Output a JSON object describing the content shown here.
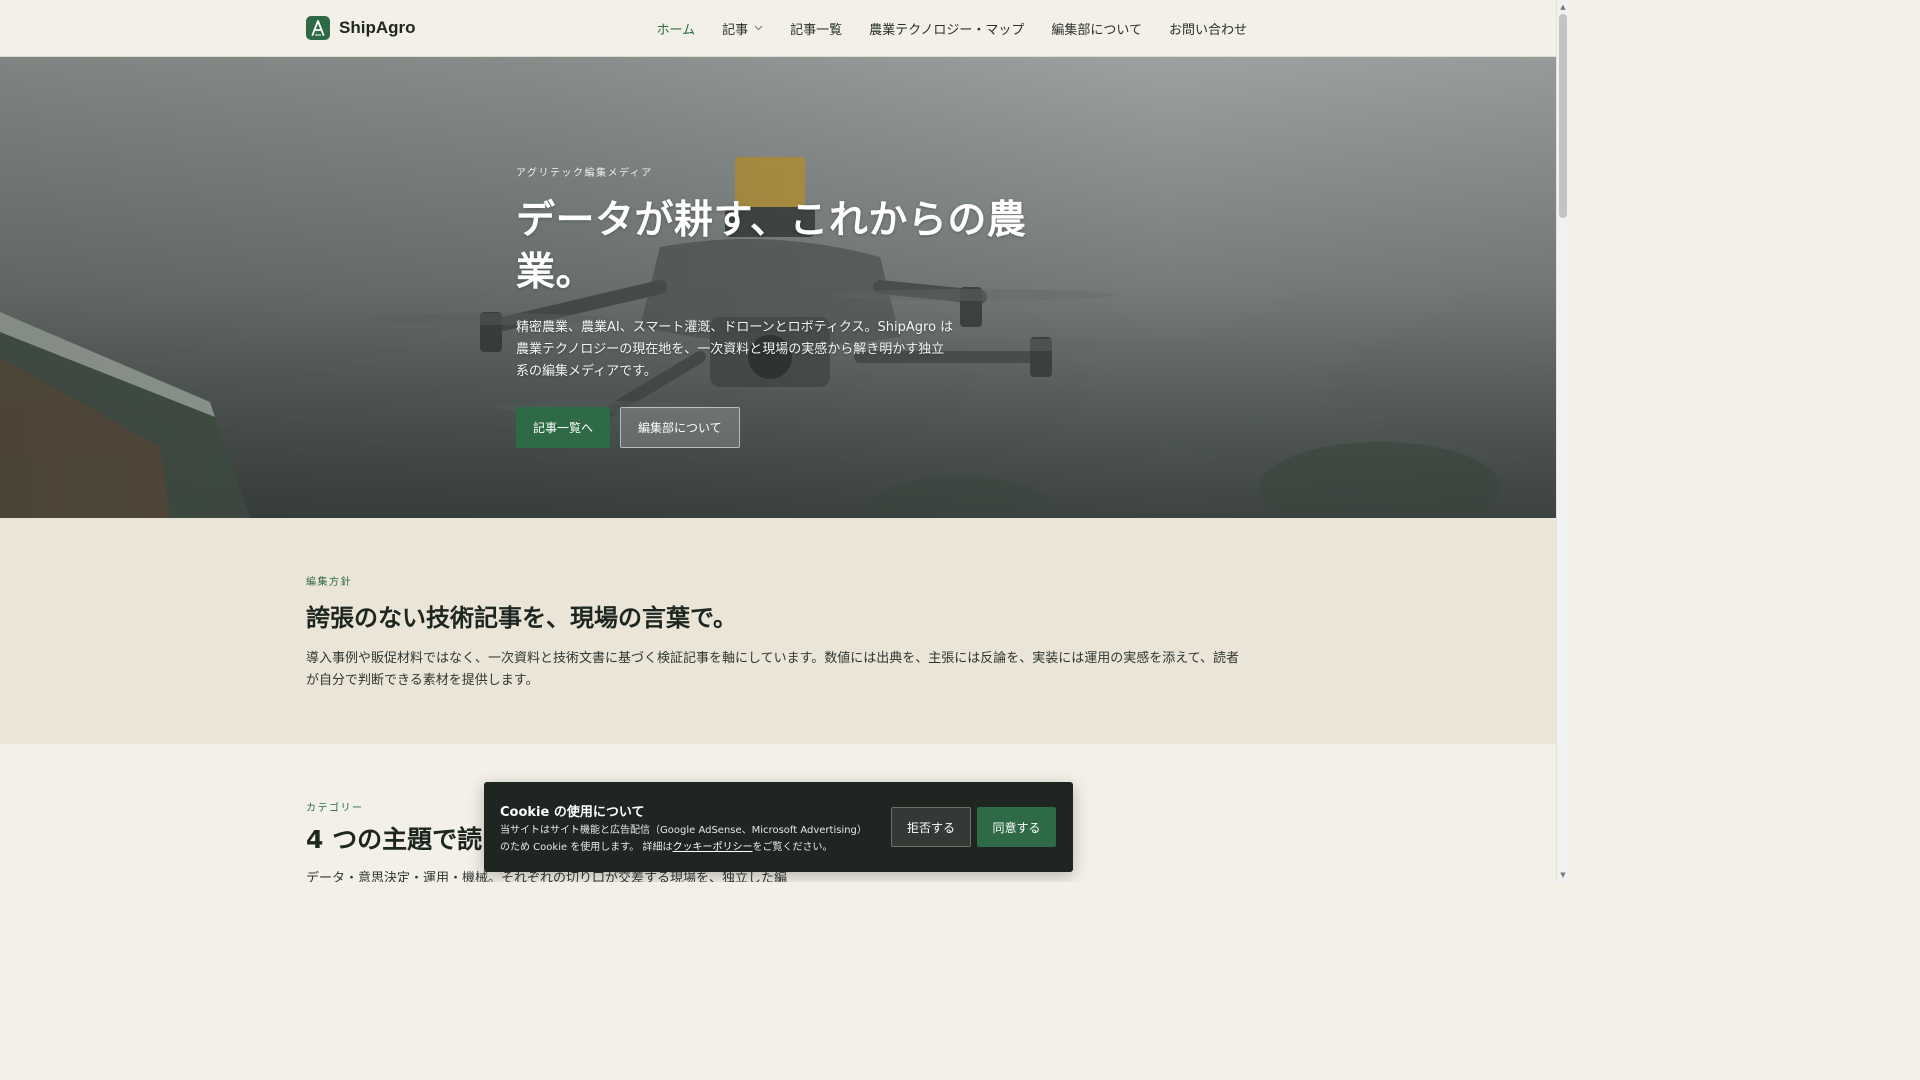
{
  "brand": {
    "name": "ShipAgro",
    "logo_icon": "leaf-a-logo-icon",
    "accent": "#2d6a45"
  },
  "nav": {
    "home": "ホーム",
    "articles": "記事",
    "article_list": "記事一覧",
    "map": "農業テクノロジー・マップ",
    "about": "編集部について",
    "contact": "お問い合わせ"
  },
  "hero": {
    "eyebrow": "アグリテック編集メディア",
    "title_line1": "データが耕す、これからの農",
    "title_line2": "業。",
    "description": "精密農業、農業AI、スマート灌漑、ドローンとロボティクス。ShipAgro は農業テクノロジーの現在地を、一次資料と現場の実感から解き明かす独立系の編集メディアです。",
    "primary_button": "記事一覧へ",
    "secondary_button": "編集部について"
  },
  "policy": {
    "eyebrow": "編集方針",
    "title": "誇張のない技術記事を、現場の言葉で。",
    "text": "導入事例や販促材料ではなく、一次資料と技術文書に基づく検証記事を軸にしています。数値には出典を、主張には反論を、実装には運用の実感を添えて、読者が自分で判断できる素材を提供します。"
  },
  "categories": {
    "eyebrow": "カテゴリー",
    "title": "4 つの主題で読",
    "text": "データ・意思決定・運用・機械。それぞれの切り口が交差する現場を、独立した編"
  },
  "cookie": {
    "title": "Cookie の使用について",
    "text_before": "当サイトはサイト機能と広告配信（Google AdSense、Microsoft Advertising）のため Cookie を使用します。 詳細は",
    "link": "クッキーポリシー",
    "text_after": "をご覧ください。",
    "reject": "拒否する",
    "accept": "同意する"
  }
}
